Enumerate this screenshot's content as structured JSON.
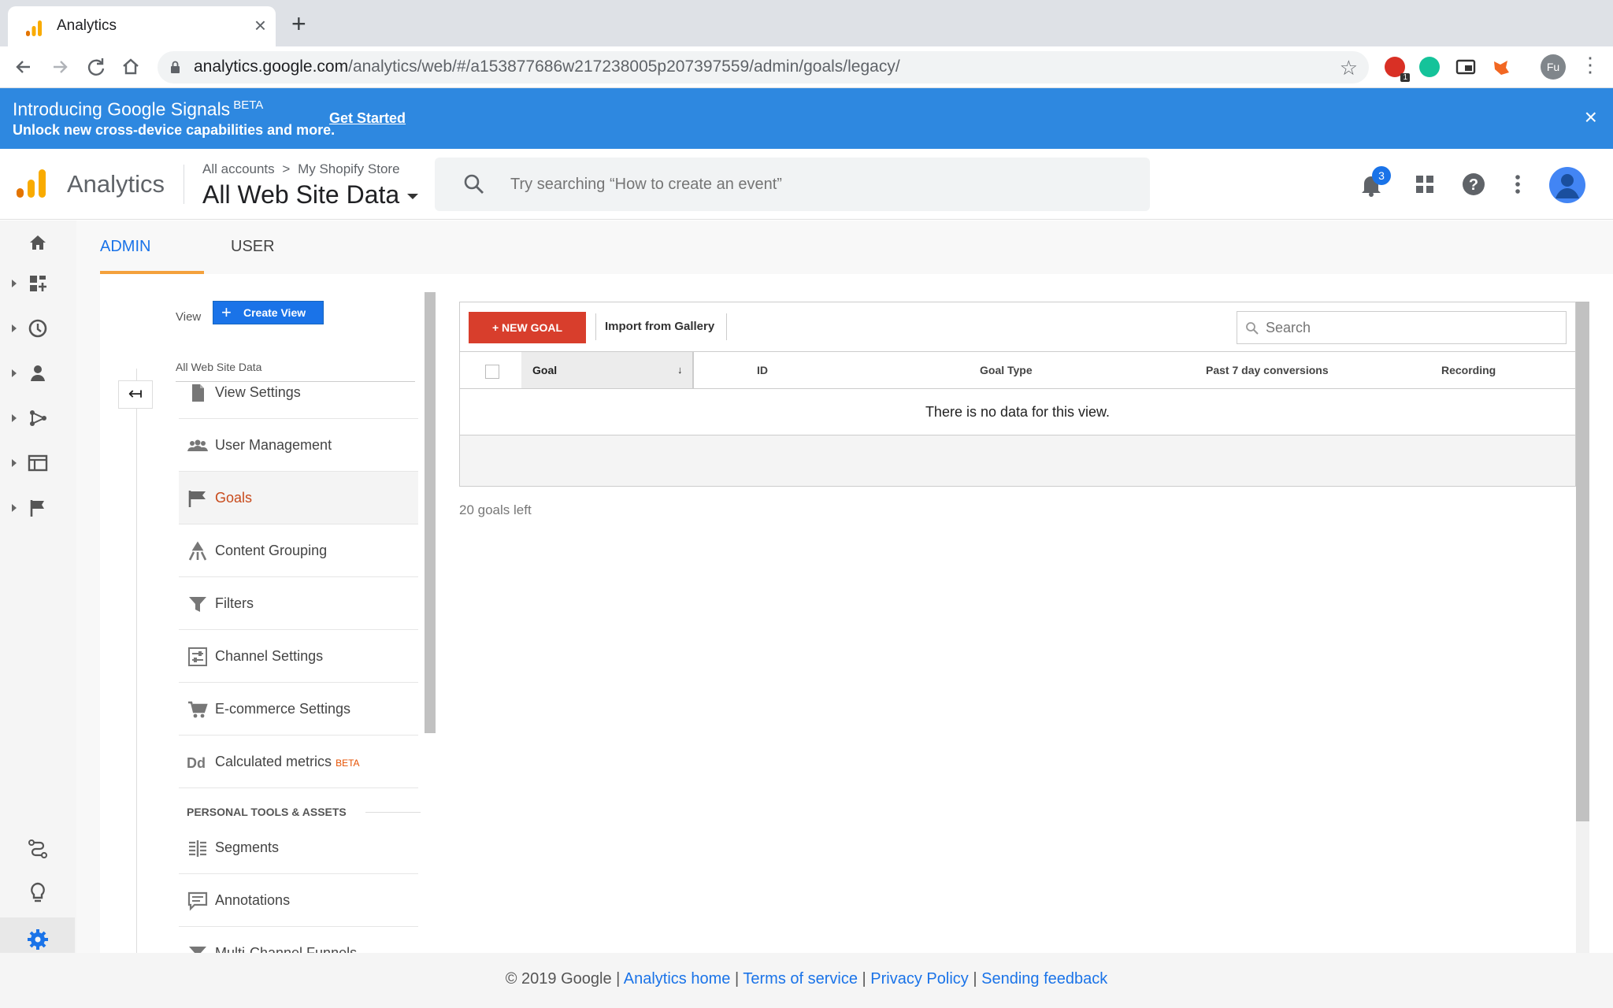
{
  "browser": {
    "tab_title": "Analytics",
    "tab_close": "×",
    "new_tab": "+",
    "url_host": "analytics.google.com",
    "url_path": "/analytics/web/#/a153877686w217238005p207397559/admin/goals/legacy/",
    "profile_initials": "Fu",
    "extension_badge": "1"
  },
  "banner": {
    "title": "Introducing Google Signals",
    "beta": "BETA",
    "subtitle": "Unlock new cross-device capabilities and more.",
    "link": "Get Started",
    "close": "×"
  },
  "header": {
    "app_name": "Analytics",
    "crumb_all": "All accounts",
    "crumb_sep": ">",
    "crumb_store": "My Shopify Store",
    "view_title": "All Web Site Data",
    "search_placeholder": "Try searching “How to create an event”",
    "notification_count": "3"
  },
  "tabs": {
    "admin": "ADMIN",
    "user": "USER"
  },
  "view_column": {
    "label": "View",
    "create_button": "Create View",
    "plus": "+",
    "view_name": "All Web Site Data",
    "back": "↤"
  },
  "menu": {
    "items": [
      {
        "label": "View Settings"
      },
      {
        "label": "User Management"
      },
      {
        "label": "Goals"
      },
      {
        "label": "Content Grouping"
      },
      {
        "label": "Filters"
      },
      {
        "label": "Channel Settings"
      },
      {
        "label": "E-commerce Settings"
      },
      {
        "label": "Calculated metrics",
        "badge": "BETA"
      }
    ],
    "section_title": "PERSONAL TOOLS & ASSETS",
    "tools": [
      {
        "label": "Segments"
      },
      {
        "label": "Annotations"
      },
      {
        "label": "Multi-Channel Funnels"
      }
    ]
  },
  "goals": {
    "new_goal": "+ NEW GOAL",
    "import": "Import from Gallery",
    "search_placeholder": "Search",
    "columns": {
      "goal": "Goal",
      "sort": "↓",
      "id": "ID",
      "type": "Goal Type",
      "past": "Past 7 day conversions",
      "recording": "Recording"
    },
    "empty": "There is no data for this view.",
    "remaining": "20 goals left"
  },
  "footer": {
    "copyright": "© 2019 Google |",
    "home": "Analytics home",
    "terms": "Terms of service",
    "privacy": "Privacy Policy",
    "feedback": "Sending feedback",
    "sep": "|"
  },
  "colors": {
    "banner": "#2e88e0",
    "accent": "#1a73e8",
    "new_goal": "#d83e2c",
    "tab_underline": "#f4a13c",
    "active_menu": "#c84a1b"
  }
}
